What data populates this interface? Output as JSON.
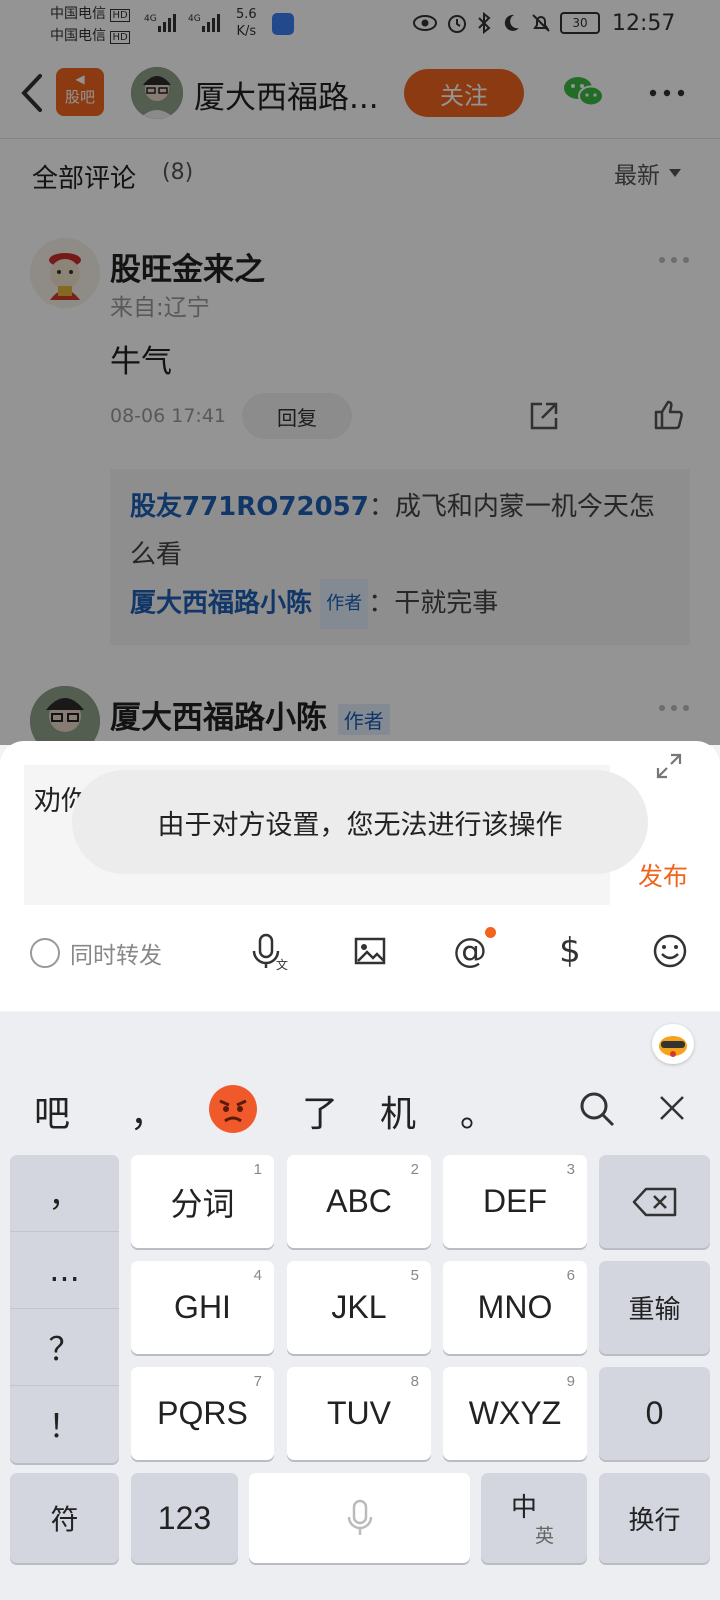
{
  "status_bar": {
    "carrier1": "中国电信",
    "carrier2": "中国电信",
    "hd": "HD",
    "net_type": "4G",
    "speed_value": "5.6",
    "speed_unit": "K/s",
    "battery": "30",
    "time": "12:57"
  },
  "header": {
    "app_logo_label": "股吧",
    "title": "厦大西福路...",
    "follow_label": "关注"
  },
  "comments_section": {
    "title": "全部评论",
    "count": "(8)",
    "sort_label": "最新"
  },
  "comment1": {
    "author": "股旺金来之",
    "location": "来自:辽宁",
    "text": "牛气",
    "timestamp": "08-06 17:41",
    "reply_label": "回复",
    "replies": [
      {
        "user": "股友771RO72057",
        "sep": "：",
        "text": "成飞和内蒙一机今天怎么看"
      },
      {
        "user": "厦大西福路小陈",
        "tag": "作者",
        "sep": "：",
        "text": "干就完事"
      }
    ]
  },
  "comment2": {
    "author": "厦大西福路小陈",
    "tag": "作者"
  },
  "reply_panel": {
    "input_text": "劝你收手",
    "publish_label": "发布",
    "forward_label": "同时转发"
  },
  "toast": {
    "message": "由于对方设置，您无法进行该操作"
  },
  "keyboard": {
    "candidates": [
      "吧",
      "，",
      "了",
      "机",
      "。"
    ],
    "symbols": [
      "，",
      "...",
      "？",
      "！"
    ],
    "keys": [
      {
        "label": "分词",
        "num": "1"
      },
      {
        "label": "ABC",
        "num": "2"
      },
      {
        "label": "DEF",
        "num": "3"
      },
      {
        "label": "GHI",
        "num": "4"
      },
      {
        "label": "JKL",
        "num": "5"
      },
      {
        "label": "MNO",
        "num": "6"
      },
      {
        "label": "PQRS",
        "num": "7"
      },
      {
        "label": "TUV",
        "num": "8"
      },
      {
        "label": "WXYZ",
        "num": "9"
      }
    ],
    "retype_label": "重输",
    "zero_label": "0",
    "symbols_key_label": "符",
    "num_key_label": "123",
    "lang_key_main": "中",
    "lang_key_sub": "英",
    "enter_label": "换行"
  },
  "colors": {
    "accent_orange": "#f0641e",
    "link_blue": "#1e5fb4",
    "wechat_green": "#3dbb45"
  }
}
